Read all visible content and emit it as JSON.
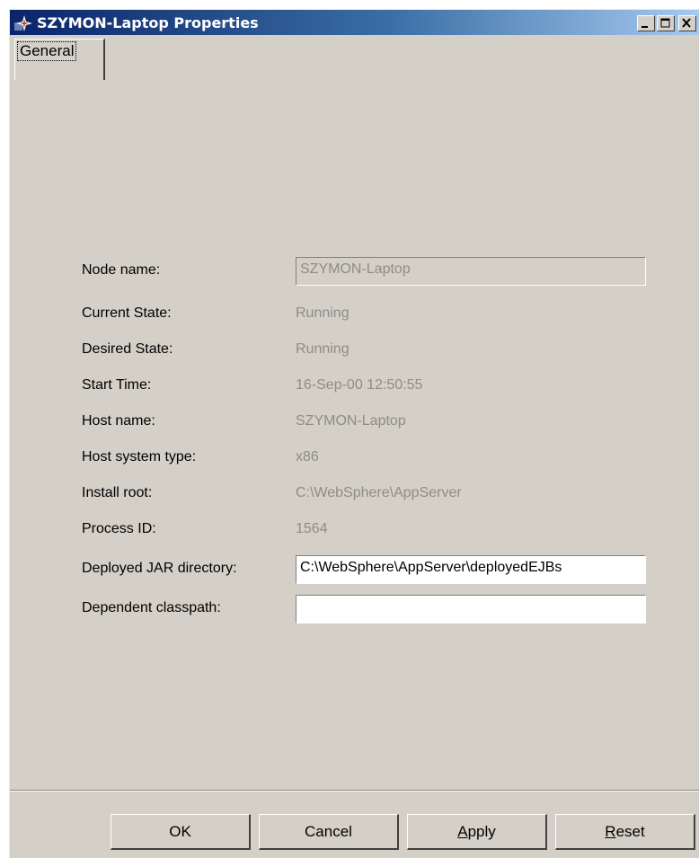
{
  "window": {
    "title": "SZYMON-Laptop Properties"
  },
  "tabs": [
    {
      "label": "General",
      "selected": true
    }
  ],
  "fields": [
    {
      "label": "Node name:",
      "value": "SZYMON-Laptop"
    },
    {
      "label": "Current State:",
      "value": "Running"
    },
    {
      "label": "Desired State:",
      "value": "Running"
    },
    {
      "label": "Start Time:",
      "value": "16-Sep-00 12:50:55"
    },
    {
      "label": "Host name:",
      "value": "SZYMON-Laptop"
    },
    {
      "label": "Host system type:",
      "value": "x86"
    },
    {
      "label": "Install root:",
      "value": "C:\\WebSphere\\AppServer"
    },
    {
      "label": "Process ID:",
      "value": "1564"
    },
    {
      "label": "Deployed JAR directory:",
      "value": "C:\\WebSphere\\AppServer\\deployedEJBs"
    },
    {
      "label": "Dependent classpath:",
      "value": ""
    }
  ],
  "buttons": {
    "ok": "OK",
    "cancel": "Cancel",
    "apply_first": "A",
    "apply_rest": "pply",
    "reset_first": "R",
    "reset_rest": "eset"
  },
  "colors": {
    "titlebar_start": "#0a246a",
    "titlebar_end": "#a6caf0",
    "dialog_bg": "#d4d0c8",
    "disabled_text": "#8e8c88"
  },
  "icons": [
    "app-icon",
    "minimize-icon",
    "maximize-icon",
    "close-icon"
  ]
}
